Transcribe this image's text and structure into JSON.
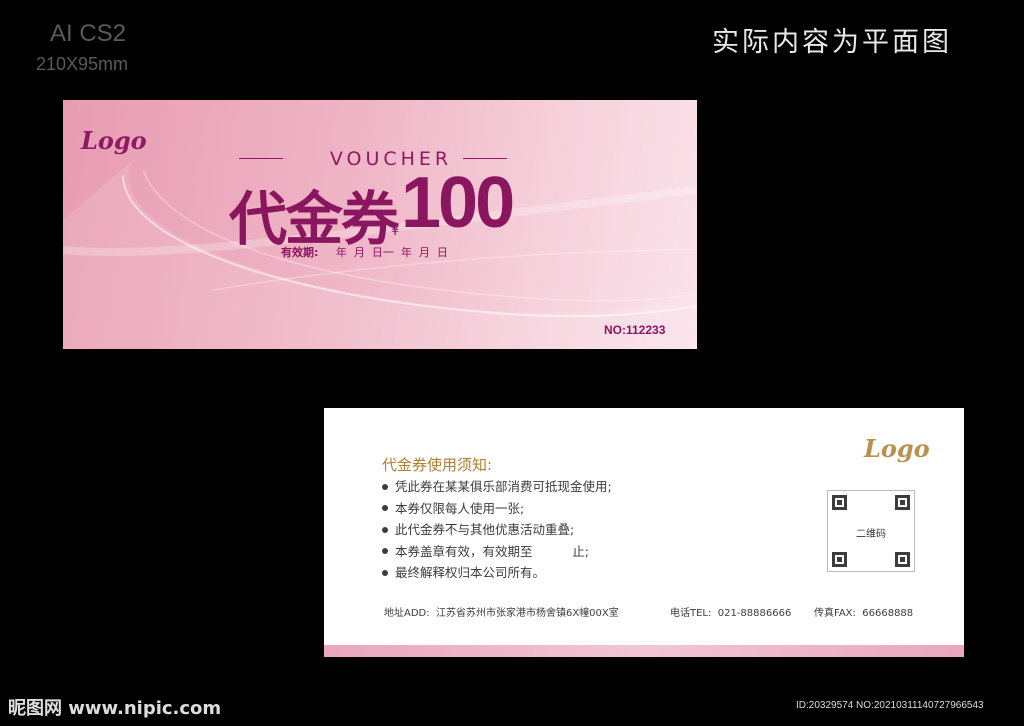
{
  "spec": {
    "software": "AI CS2",
    "size": "210X95mm"
  },
  "top_note": "实际内容为平面图",
  "front": {
    "logo": "Logo",
    "subtitle": "VOUCHER",
    "title": "代金券",
    "currency": "¥",
    "amount": "100",
    "validity_label": "有效期:",
    "validity_dates": "年  月  日一  年  月  日",
    "serial": "NO:112233",
    "colors": {
      "primary": "#8b1660",
      "background": "#efb5c6"
    }
  },
  "back": {
    "logo": "Logo",
    "notes_title": "代金券使用须知:",
    "rules": [
      "凭此券在某某俱乐部消费可抵现金使用;",
      "本券仅限每人使用一张;",
      "此代金券不与其他优惠活动重叠;",
      "本券盖章有效，有效期至          止;",
      "最终解释权归本公司所有。"
    ],
    "qr_label": "二维码",
    "address": "地址ADD:  江苏省苏州市张家港市杨舍镇6X幢00X室",
    "phone": "电话TEL:  021-88886666",
    "fax": "传真FAX:  66668888"
  },
  "watermark": {
    "site": "昵图网 www.nipic.com",
    "id": "ID:20329574 NO:20210311140727966543"
  }
}
